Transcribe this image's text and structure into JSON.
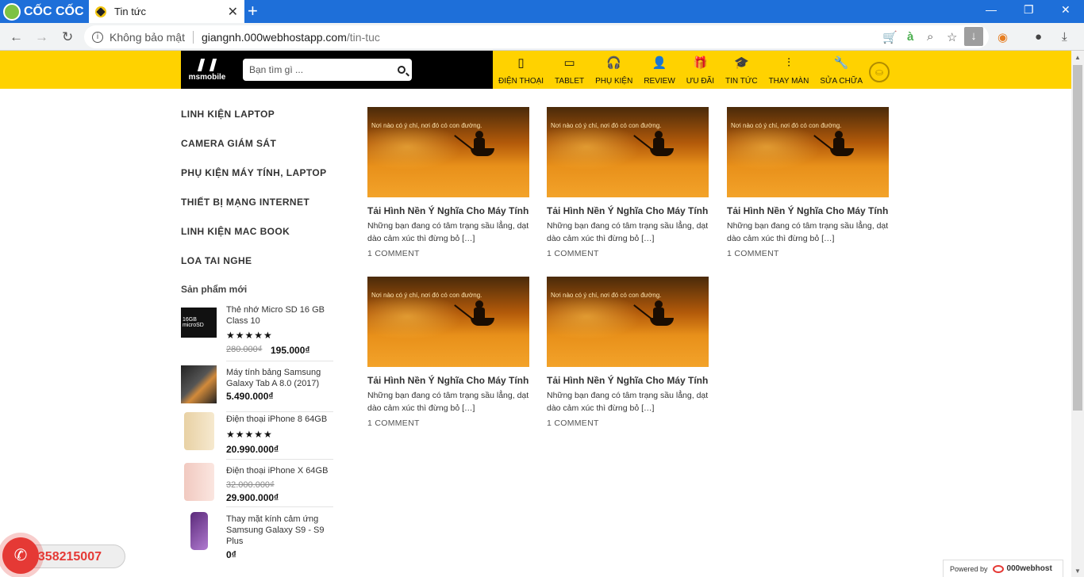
{
  "browser": {
    "brand": "CỐC CỐC",
    "tab_title": "Tin tức",
    "security_label": "Không bảo mật",
    "url_host": "giangnh.000webhostapp.com",
    "url_path": "/tin-tuc"
  },
  "header": {
    "logo_text": "msmobile",
    "search_placeholder": "Bạn tìm gì ...",
    "nav": [
      {
        "label": "ĐIỆN THOẠI",
        "icon": "phone-icon"
      },
      {
        "label": "TABLET",
        "icon": "tablet-icon"
      },
      {
        "label": "PHỤ KIỆN",
        "icon": "headphones-icon"
      },
      {
        "label": "REVIEW",
        "icon": "user-icon"
      },
      {
        "label": "ƯU ĐÃI",
        "icon": "gift-icon"
      },
      {
        "label": "TIN TỨC",
        "icon": "graduation-cap-icon"
      },
      {
        "label": "THAY MÀN",
        "icon": "sliders-icon"
      },
      {
        "label": "SỬA CHỮA",
        "icon": "wrench-icon"
      }
    ]
  },
  "sidebar": {
    "categories": [
      "LINH KIỆN LAPTOP",
      "CAMERA GIÁM SÁT",
      "PHỤ KIỆN MÁY TÍNH, LAPTOP",
      "THIẾT BỊ MẠNG INTERNET",
      "LINH KIỆN MAC BOOK",
      "LOA TAI NGHE"
    ],
    "new_products_title": "Sản phẩm mới",
    "products": [
      {
        "name": "Thẻ nhớ Micro SD 16 GB Class 10",
        "stars": "★★★★★",
        "old_price": "280.000₫",
        "price": "195.000₫"
      },
      {
        "name": "Máy tính bảng Samsung Galaxy Tab A 8.0 (2017)",
        "price": "5.490.000₫"
      },
      {
        "name": "Điện thoại iPhone 8 64GB",
        "stars": "★★★★★",
        "price": "20.990.000₫"
      },
      {
        "name": "Điện thoại iPhone X 64GB",
        "old_price": "32.000.000₫",
        "price": "29.900.000₫"
      },
      {
        "name": "Thay mặt kính cảm ứng Samsung Galaxy S9 - S9 Plus",
        "price": "0₫"
      }
    ]
  },
  "posts": [
    {
      "title": "Tải Hình Nền Ý Nghĩa Cho Máy Tính",
      "excerpt": "Những bạn đang có tâm trạng sầu lẳng, dạt dào cảm xúc thì đừng bỏ […]",
      "comments": "1 COMMENT",
      "image_caption": "Nơi nào có ý chí, nơi đó có con đường."
    },
    {
      "title": "Tải Hình Nền Ý Nghĩa Cho Máy Tính",
      "excerpt": "Những bạn đang có tâm trạng sầu lẳng, dạt dào cảm xúc thì đừng bỏ […]",
      "comments": "1 COMMENT",
      "image_caption": "Nơi nào có ý chí, nơi đó có con đường."
    },
    {
      "title": "Tải Hình Nền Ý Nghĩa Cho Máy Tính",
      "excerpt": "Những bạn đang có tâm trạng sầu lẳng, dạt dào cảm xúc thì đừng bỏ […]",
      "comments": "1 COMMENT",
      "image_caption": "Nơi nào có ý chí, nơi đó có con đường."
    },
    {
      "title": "Tải Hình Nền Ý Nghĩa Cho Máy Tính",
      "excerpt": "Những bạn đang có tâm trạng sầu lẳng, dạt dào cảm xúc thì đừng bỏ […]",
      "comments": "1 COMMENT",
      "image_caption": "Nơi nào có ý chí, nơi đó có con đường."
    },
    {
      "title": "Tải Hình Nền Ý Nghĩa Cho Máy Tính",
      "excerpt": "Những bạn đang có tâm trạng sầu lẳng, dạt dào cảm xúc thì đừng bỏ […]",
      "comments": "1 COMMENT",
      "image_caption": "Nơi nào có ý chí, nơi đó có con đường."
    }
  ],
  "hotline": "0358215007",
  "powered": {
    "prefix": "Powered by",
    "name": "000webhost"
  },
  "colors": {
    "header_bg": "#ffd200",
    "tabbar_bg": "#1e6fd9",
    "hotline": "#e53935"
  }
}
